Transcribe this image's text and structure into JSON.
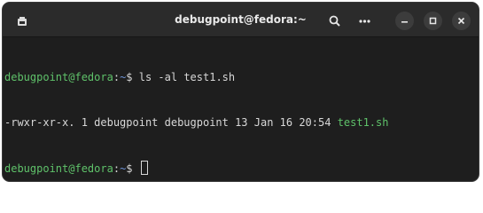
{
  "window": {
    "title": "debugpoint@fedora:~"
  },
  "titlebar": {
    "icons": {
      "new_tab": "terminal-tab-icon",
      "search": "search-icon",
      "menu": "more-horizontal-icon",
      "minimize": "minimize-icon",
      "maximize": "maximize-icon",
      "close": "close-icon"
    }
  },
  "terminal": {
    "lines": [
      {
        "user_host": "debugpoint@fedora",
        "sep": ":",
        "path": "~",
        "symbol": "$",
        "command": " ls -al test1.sh"
      },
      {
        "output_text": "-rwxr-xr-x. 1 debugpoint debugpoint 13 Jan 16 20:54 ",
        "output_file": "test1.sh"
      },
      {
        "user_host": "debugpoint@fedora",
        "sep": ":",
        "path": "~",
        "symbol": "$",
        "command": " "
      }
    ]
  },
  "colors": {
    "prompt": "#5fc26a",
    "path": "#6f95d8",
    "background": "#1e1e1e",
    "titlebar": "#2b2b2b"
  }
}
